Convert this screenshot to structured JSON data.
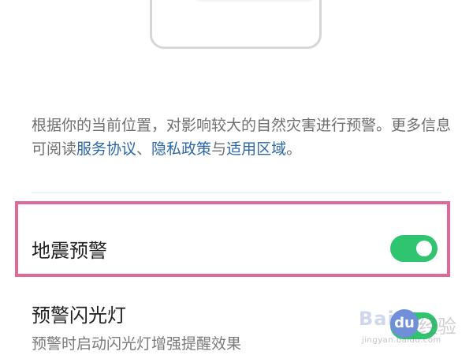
{
  "description": {
    "prefix": "根据你的当前位置，对影响较大的自然灾害进行预警。更多信息可阅读",
    "link_service": "服务协议",
    "sep1": "、",
    "link_privacy": "隐私政策",
    "sep2": "与",
    "link_region": "适用区域",
    "suffix": "。"
  },
  "settings": [
    {
      "title": "地震预警",
      "enabled": true
    },
    {
      "title": "预警闪光灯",
      "subtitle": "预警时启动闪光灯增强提醒效果",
      "enabled": true
    }
  ],
  "watermark": {
    "logo": "Bai",
    "badge": "du",
    "jy": "经验",
    "url": "jingyan.baidu.com"
  },
  "colors": {
    "toggle_on": "#2fc46f",
    "link": "#2b66a8",
    "highlight": "#e0699a"
  }
}
